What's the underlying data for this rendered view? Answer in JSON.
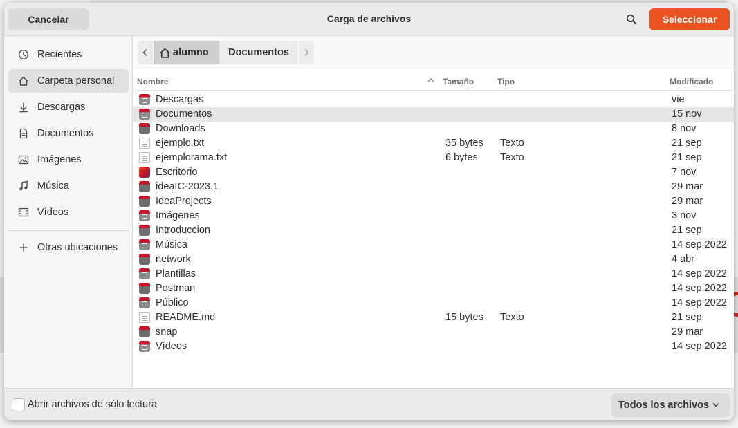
{
  "header": {
    "cancel_label": "Cancelar",
    "title": "Carga de archivos",
    "select_label": "Seleccionar",
    "accent_color": "#e95420"
  },
  "sidebar": {
    "items": [
      {
        "label": "Recientes",
        "icon": "clock-icon"
      },
      {
        "label": "Carpeta personal",
        "icon": "home-icon",
        "active": true
      },
      {
        "label": "Descargas",
        "icon": "download-icon"
      },
      {
        "label": "Documentos",
        "icon": "document-icon"
      },
      {
        "label": "Imágenes",
        "icon": "image-icon"
      },
      {
        "label": "Música",
        "icon": "music-icon"
      },
      {
        "label": "Vídeos",
        "icon": "film-icon"
      }
    ],
    "other_label": "Otras ubicaciones"
  },
  "pathbar": {
    "home_label": "alumno",
    "current_label": "Documentos"
  },
  "columns": {
    "name": "Nombre",
    "size": "Tamaño",
    "type": "Tipo",
    "modified": "Modificado"
  },
  "files": [
    {
      "name": "Descargas",
      "size": "",
      "type": "",
      "modified": "vie",
      "icon": "folder-download-icon"
    },
    {
      "name": "Documentos",
      "size": "",
      "type": "",
      "modified": "15 nov",
      "icon": "folder-documents-icon",
      "selected": true
    },
    {
      "name": "Downloads",
      "size": "",
      "type": "",
      "modified": "8 nov",
      "icon": "folder-icon"
    },
    {
      "name": "ejemplo.txt",
      "size": "35 bytes",
      "type": "Texto",
      "modified": "21 sep",
      "icon": "text-file-icon"
    },
    {
      "name": "ejemplorama.txt",
      "size": "6 bytes",
      "type": "Texto",
      "modified": "21 sep",
      "icon": "text-file-icon"
    },
    {
      "name": "Escritorio",
      "size": "",
      "type": "",
      "modified": "7 nov",
      "icon": "desktop-folder-icon"
    },
    {
      "name": "ideaIC-2023.1",
      "size": "",
      "type": "",
      "modified": "29 mar",
      "icon": "folder-icon"
    },
    {
      "name": "IdeaProjects",
      "size": "",
      "type": "",
      "modified": "29 mar",
      "icon": "folder-icon"
    },
    {
      "name": "Imágenes",
      "size": "",
      "type": "",
      "modified": "3 nov",
      "icon": "folder-pictures-icon"
    },
    {
      "name": "Introduccion",
      "size": "",
      "type": "",
      "modified": "21 sep",
      "icon": "folder-icon"
    },
    {
      "name": "Música",
      "size": "",
      "type": "",
      "modified": "14 sep 2022",
      "icon": "folder-music-icon"
    },
    {
      "name": "network",
      "size": "",
      "type": "",
      "modified": "4 abr",
      "icon": "folder-icon"
    },
    {
      "name": "Plantillas",
      "size": "",
      "type": "",
      "modified": "14 sep 2022",
      "icon": "folder-templates-icon"
    },
    {
      "name": "Postman",
      "size": "",
      "type": "",
      "modified": "14 sep 2022",
      "icon": "folder-icon"
    },
    {
      "name": "Público",
      "size": "",
      "type": "",
      "modified": "14 sep 2022",
      "icon": "folder-public-icon"
    },
    {
      "name": "README.md",
      "size": "15 bytes",
      "type": "Texto",
      "modified": "21 sep",
      "icon": "markdown-file-icon"
    },
    {
      "name": "snap",
      "size": "",
      "type": "",
      "modified": "29 mar",
      "icon": "folder-icon"
    },
    {
      "name": "Vídeos",
      "size": "",
      "type": "",
      "modified": "14 sep 2022",
      "icon": "folder-videos-icon"
    }
  ],
  "footer": {
    "readonly_label": "Abrir archivos de sólo lectura",
    "readonly_checked": false,
    "filter_label": "Todos los archivos"
  }
}
